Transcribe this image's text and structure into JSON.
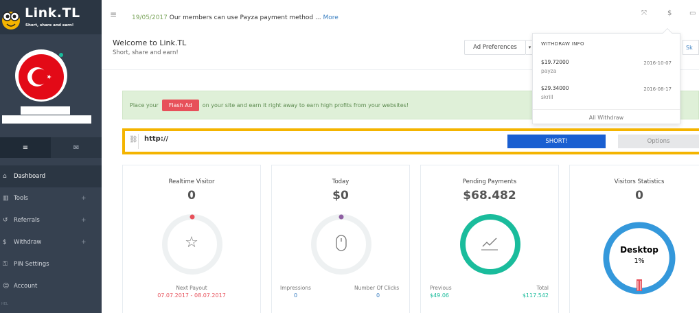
{
  "brand": {
    "title": "Link.TL",
    "subtitle": "Short, share and earn!"
  },
  "sidebar": {
    "tabs": [
      {
        "icon": "hamburger-icon",
        "glyph": "≡"
      },
      {
        "icon": "envelope-icon",
        "glyph": "✉"
      }
    ],
    "items": [
      {
        "label": "Dashboard",
        "glyph": "⌂",
        "icon": "home-icon",
        "expandable": false
      },
      {
        "label": "Tools",
        "glyph": "▥",
        "icon": "tools-icon",
        "expandable": true
      },
      {
        "label": "Referrals",
        "glyph": "↺",
        "icon": "referrals-icon",
        "expandable": true
      },
      {
        "label": "Withdraw",
        "glyph": "$",
        "icon": "dollar-icon",
        "expandable": true
      },
      {
        "label": "PIN Settings",
        "glyph": "⚿",
        "icon": "key-icon",
        "expandable": false
      },
      {
        "label": "Account",
        "glyph": "☺",
        "icon": "user-icon",
        "expandable": false
      }
    ],
    "plus_glyph": "+",
    "footer_text": "HEL"
  },
  "topbar": {
    "menu_glyph": "≡",
    "announcement_date": "19/05/2017",
    "announcement_text": " Our members can use Payza payment method ... ",
    "announcement_more": "More",
    "icons": [
      {
        "name": "fullscreen-icon",
        "glyph": "⤧"
      },
      {
        "name": "dollar-icon",
        "glyph": "$"
      },
      {
        "name": "comment-icon",
        "glyph": "▭"
      }
    ]
  },
  "header": {
    "title": "Welcome to Link.TL",
    "subtitle": "Short, share and earn!",
    "ad_preferences": "Ad Preferences",
    "dropdown_glyph": "▾",
    "skype_label": "Sk"
  },
  "alert": {
    "before": "Place your ",
    "button": "Flash Ad",
    "after": " on your site and earn it right away to earn high profits from your websites!"
  },
  "shortener": {
    "link_glyph": "⛓",
    "url_value": "http://",
    "short_button": "SHORT!",
    "options_button": "Options"
  },
  "cards": {
    "realtime": {
      "title": "Realtime Visitor",
      "value": "0",
      "glyph": "☆",
      "footer_label": "Next Payout",
      "footer_value": "07.07.2017 - 08.07.2017",
      "ring_color": "#eef1f2",
      "dot_color": "#e7505a"
    },
    "today": {
      "title": "Today",
      "value": "$0",
      "glyph": "🖱",
      "impressions_label": "Impressions",
      "impressions_value": "0",
      "clicks_label": "Number Of Clicks",
      "clicks_value": "0",
      "ring_color": "#eef1f2",
      "dot_color": "#8e5fa2"
    },
    "pending": {
      "title": "Pending Payments",
      "value": "$68.482",
      "glyph": "↗",
      "previous_label": "Previous",
      "previous_value": "$49.06",
      "total_label": "Total",
      "total_value": "$117.542",
      "ring_color": "#1abc9c"
    },
    "visitors": {
      "title": "Visitors Statistics",
      "value": "0",
      "device_label": "Desktop",
      "device_percent": "1%",
      "device_share": 1,
      "ring_color": "#3498db",
      "accent_color": "#e7505a"
    }
  },
  "withdraw_dropdown": {
    "header": "WITHDRAW INFO",
    "entries": [
      {
        "amount": "$19.72000",
        "method": "payza",
        "date": "2016-10-07"
      },
      {
        "amount": "$29.34000",
        "method": "skrill",
        "date": "2016-08-17"
      }
    ],
    "footer": "All Withdraw"
  }
}
